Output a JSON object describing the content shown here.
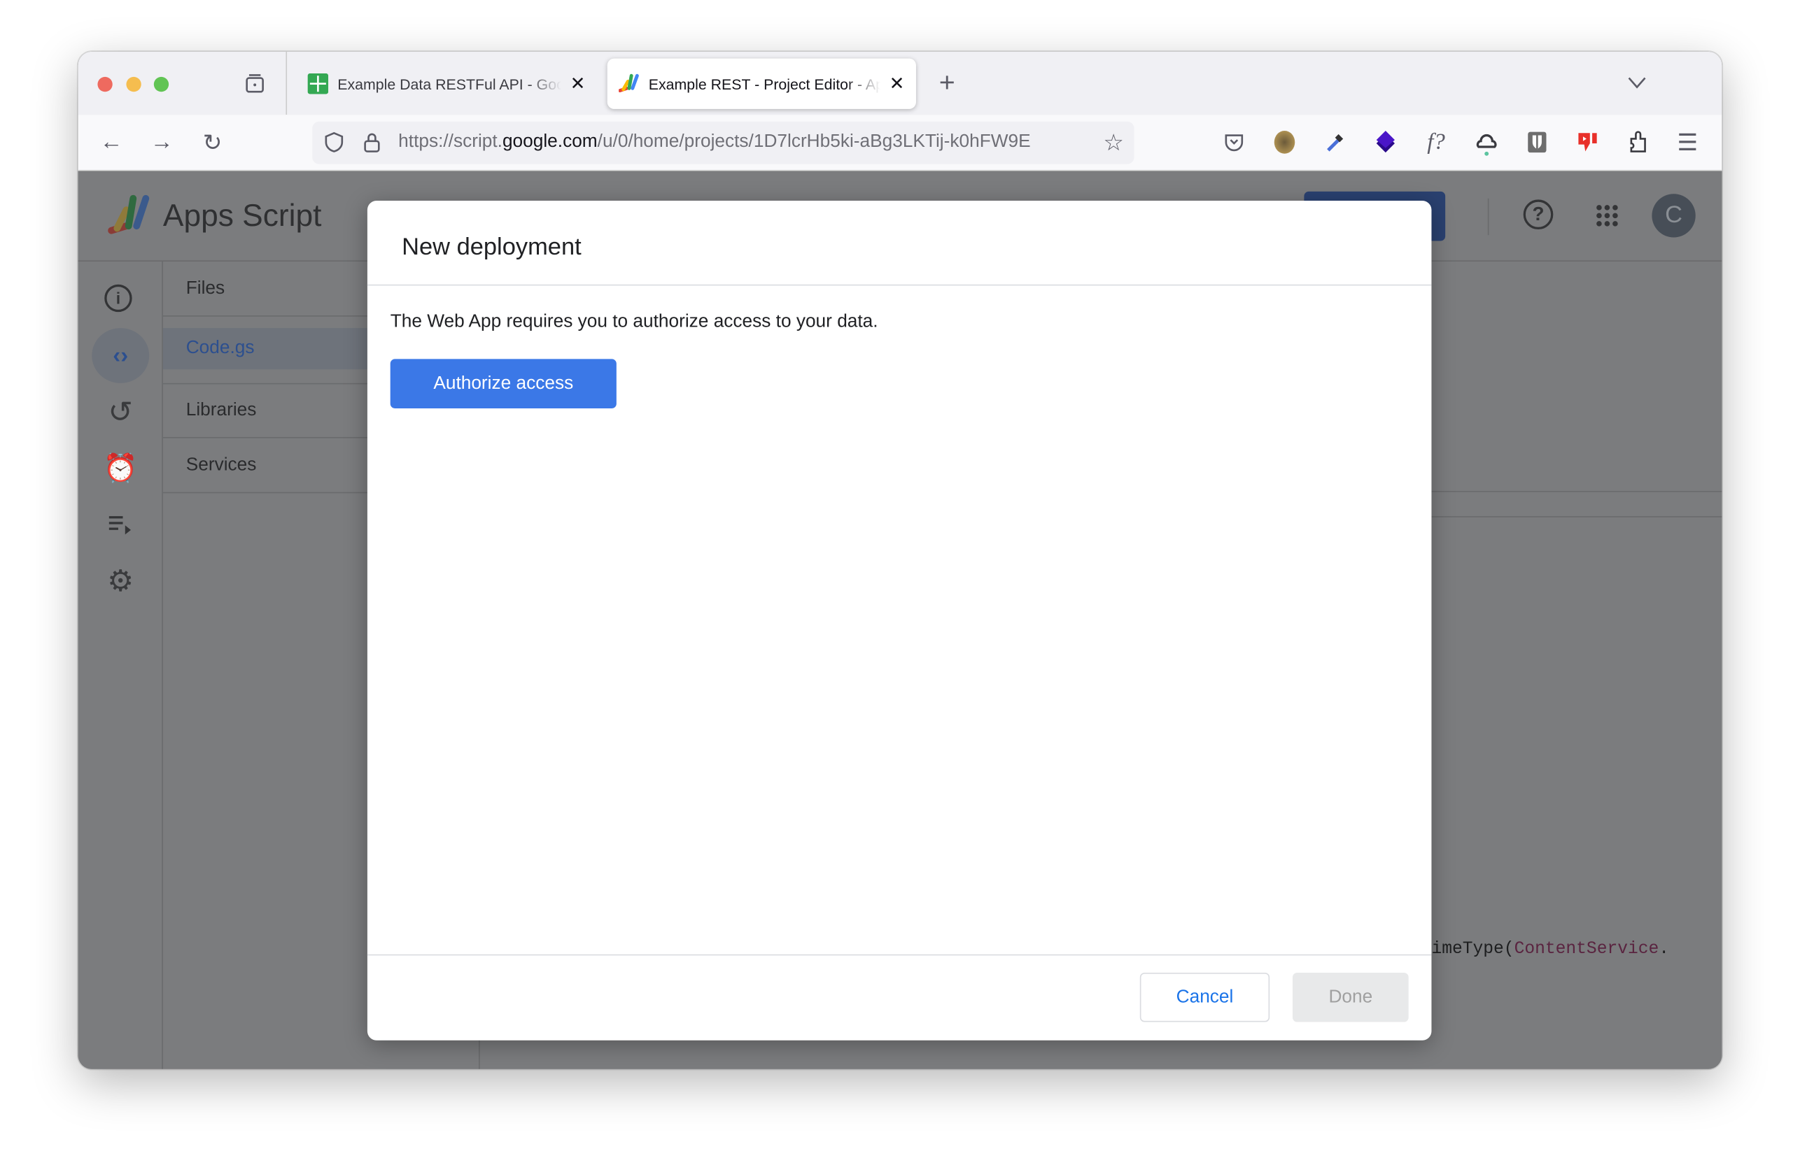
{
  "browser": {
    "tabs": [
      {
        "title": "Example Data RESTFul API - Google Sheets",
        "icon": "google-sheets-icon",
        "active": false
      },
      {
        "title": "Example REST - Project Editor - Apps Script",
        "icon": "apps-script-icon",
        "active": true
      }
    ],
    "url_prefix": "https://script.",
    "url_domain": "google.com",
    "url_path": "/u/0/home/projects/1D7lcrHb5ki-aBg3LKTij-k0hFW9E",
    "extensions": [
      "pocket-icon",
      "avatar-extension-icon",
      "eyedropper-icon",
      "diamond-extension-icon",
      "font-finder-icon",
      "cloud-icon",
      "bitwarden-icon",
      "dislike-icon",
      "extensions-puzzle-icon",
      "menu-icon"
    ]
  },
  "app": {
    "name": "Apps Script",
    "avatar_letter": "C",
    "sidebar": {
      "files_label": "Files",
      "file": "Code.gs",
      "libraries_label": "Libraries",
      "services_label": "Services"
    },
    "code_fragment_a": "imeType(",
    "code_fragment_b": "ContentService",
    "code_fragment_c": "."
  },
  "dialog": {
    "title": "New deployment",
    "message": "The Web App requires you to authorize access to your data.",
    "authorize_label": "Authorize access",
    "cancel_label": "Cancel",
    "done_label": "Done",
    "accent": "#3b78e7"
  }
}
